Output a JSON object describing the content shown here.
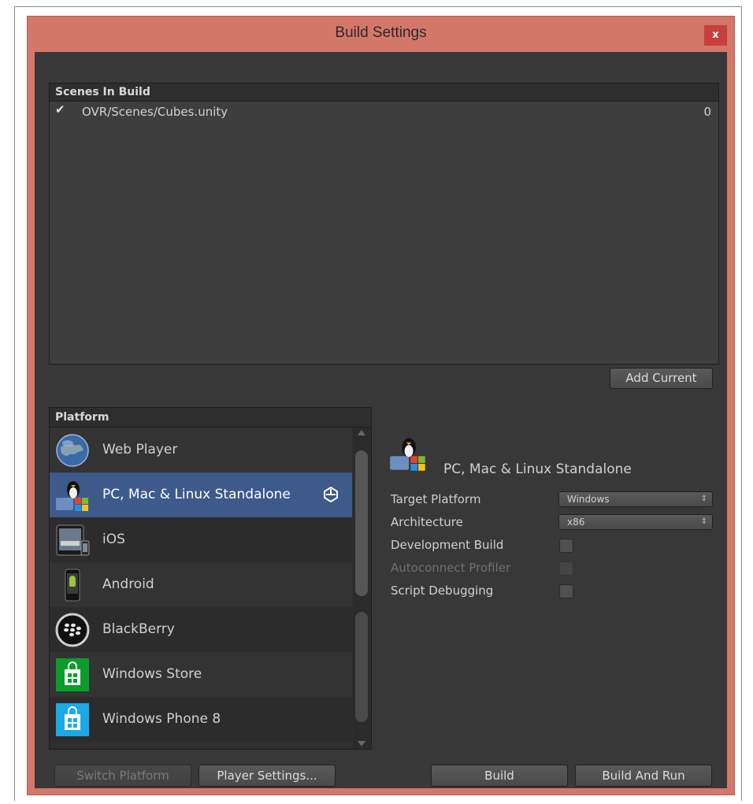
{
  "window": {
    "title": "Build Settings",
    "close_label": "x"
  },
  "scenes": {
    "header": "Scenes In Build",
    "items": [
      {
        "name": "OVR/Scenes/Cubes.unity",
        "index": "0",
        "checked": true
      }
    ],
    "add_current_label": "Add Current"
  },
  "platform": {
    "header": "Platform",
    "items": [
      {
        "label": "Web Player",
        "icon": "globe-icon"
      },
      {
        "label": "PC, Mac & Linux Standalone",
        "icon": "standalone-icon",
        "selected": true,
        "active": true
      },
      {
        "label": "iOS",
        "icon": "ios-device-icon"
      },
      {
        "label": "Android",
        "icon": "android-phone-icon"
      },
      {
        "label": "BlackBerry",
        "icon": "blackberry-icon"
      },
      {
        "label": "Windows Store",
        "icon": "windows-store-icon"
      },
      {
        "label": "Windows Phone 8",
        "icon": "windows-phone-icon"
      }
    ]
  },
  "settings": {
    "title": "PC, Mac & Linux Standalone",
    "target_platform_label": "Target Platform",
    "target_platform_value": "Windows",
    "architecture_label": "Architecture",
    "architecture_value": "x86",
    "development_build_label": "Development Build",
    "autoconnect_profiler_label": "Autoconnect Profiler",
    "script_debugging_label": "Script Debugging"
  },
  "buttons": {
    "switch_platform": "Switch Platform",
    "player_settings": "Player Settings...",
    "build": "Build",
    "build_and_run": "Build And Run"
  },
  "colors": {
    "frame": "#d4776b",
    "close": "#c7403a",
    "panel_bg": "#383838",
    "selection": "#3d5a8a"
  }
}
